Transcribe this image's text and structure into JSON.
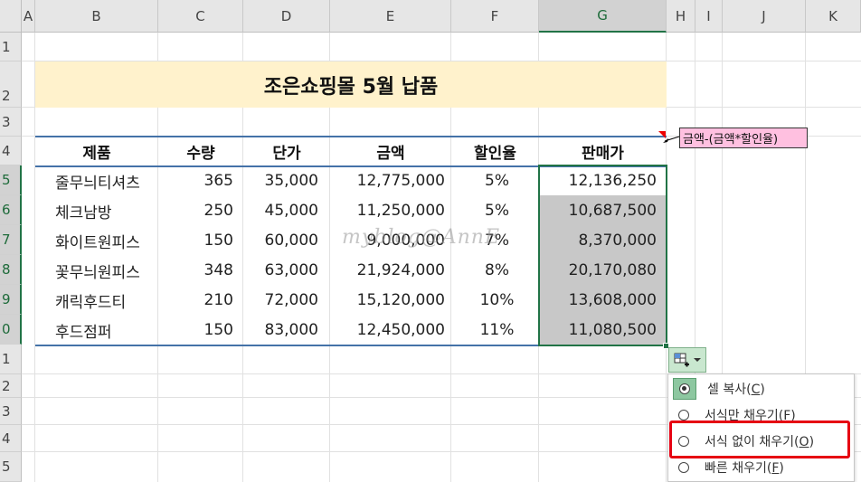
{
  "columns": [
    "A",
    "B",
    "C",
    "D",
    "E",
    "F",
    "G",
    "H",
    "I",
    "J",
    "K"
  ],
  "rows": [
    "1",
    "2",
    "3",
    "4",
    "5",
    "6",
    "7",
    "8",
    "9",
    "0",
    "1",
    "2",
    "3",
    "4",
    "5"
  ],
  "title": "조은쇼핑몰 5월 납품",
  "headers": [
    "제품",
    "수량",
    "단가",
    "금액",
    "할인율",
    "판매가"
  ],
  "table": [
    [
      "줄무늬티셔츠",
      "365",
      "35,000",
      "12,775,000",
      "5%",
      "12,136,250"
    ],
    [
      "체크남방",
      "250",
      "45,000",
      "11,250,000",
      "5%",
      "10,687,500"
    ],
    [
      "화이트원피스",
      "150",
      "60,000",
      "9,000,000",
      "7%",
      "8,370,000"
    ],
    [
      "꽃무늬원피스",
      "348",
      "63,000",
      "21,924,000",
      "8%",
      "20,170,080"
    ],
    [
      "캐릭후드티",
      "210",
      "72,000",
      "15,120,000",
      "10%",
      "13,608,000"
    ],
    [
      "후드점퍼",
      "150",
      "83,000",
      "12,450,000",
      "11%",
      "11,080,500"
    ]
  ],
  "comment": "금액-(금액*할인율)",
  "watermark": "myblog@AnnE",
  "autofill_menu": [
    {
      "label": "셀 복사(",
      "key": "C",
      "selected": true
    },
    {
      "label": "서식만 채우기(",
      "key": "F",
      "selected": false
    },
    {
      "label": "서식 없이 채우기(",
      "key": "O",
      "selected": false
    },
    {
      "label": "빠른 채우기(",
      "key": "F",
      "selected": false
    }
  ],
  "icons": {
    "autofill": "autofill-options-icon",
    "dropdown": "chevron-down-icon"
  },
  "colors": {
    "accent": "#217346",
    "title_bg": "#fff2cc",
    "highlight": "#e60012",
    "comment_bg": "#ffc0e0"
  }
}
